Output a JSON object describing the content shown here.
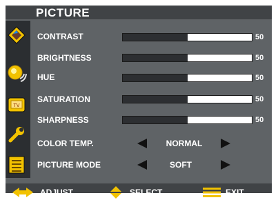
{
  "menu": {
    "title": "PICTURE"
  },
  "sidebar": {
    "icons": [
      {
        "name": "picture-icon",
        "label": "picture"
      },
      {
        "name": "sound-icon",
        "label": "sound"
      },
      {
        "name": "tv-icon",
        "label": "tv"
      },
      {
        "name": "setup-wrench-icon",
        "label": "setup"
      },
      {
        "name": "options-list-icon",
        "label": "options"
      }
    ]
  },
  "settings": [
    {
      "label": "CONTRAST",
      "value": "50",
      "level": 0.5
    },
    {
      "label": "BRIGHTNESS",
      "value": "50",
      "level": 0.5
    },
    {
      "label": "HUE",
      "value": "50",
      "level": 0.5
    },
    {
      "label": "SATURATION",
      "value": "50",
      "level": 0.5
    },
    {
      "label": "SHARPNESS",
      "value": "50",
      "level": 0.5
    }
  ],
  "selectors": [
    {
      "label": "COLOR TEMP.",
      "value": "NORMAL"
    },
    {
      "label": "PICTURE MODE",
      "value": "SOFT"
    }
  ],
  "footer": {
    "adjust": "ADJUST",
    "select": "SELECT",
    "exit": "EXIT"
  },
  "colors": {
    "panel": "#5f6366",
    "title_bar": "#404346",
    "bar_fill": "#2d2f32",
    "icon_yellow": "#f2c200"
  }
}
